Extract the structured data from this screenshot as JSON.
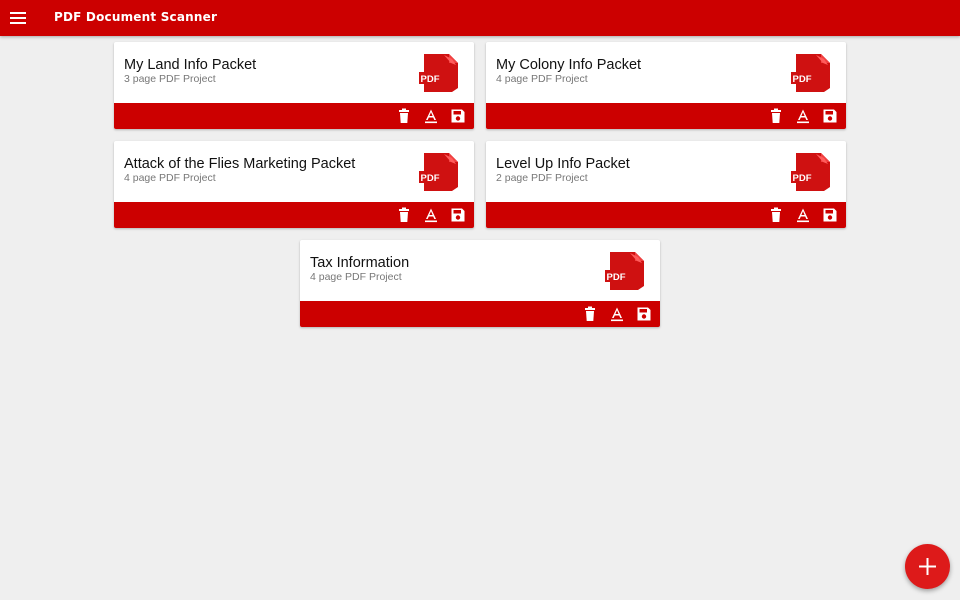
{
  "app": {
    "title": "PDF Document Scanner",
    "accent_color": "#cc0000"
  },
  "projects": [
    {
      "title": "My Land Info Packet",
      "subtitle": "3 page PDF Project",
      "icon": "pdf-file-icon"
    },
    {
      "title": "My Colony Info Packet",
      "subtitle": "4 page PDF Project",
      "icon": "pdf-file-icon"
    },
    {
      "title": "Attack of the Flies Marketing Packet",
      "subtitle": "4 page PDF Project",
      "icon": "pdf-file-icon"
    },
    {
      "title": "Level Up Info Packet",
      "subtitle": "2 page PDF Project",
      "icon": "pdf-file-icon"
    },
    {
      "title": "Tax Information",
      "subtitle": "4 page PDF Project",
      "icon": "pdf-file-icon"
    }
  ],
  "card_actions": [
    "trash-icon",
    "rename-icon",
    "save-icon"
  ],
  "pdf_icon_label": "PDF",
  "fab": {
    "icon": "plus-icon"
  }
}
